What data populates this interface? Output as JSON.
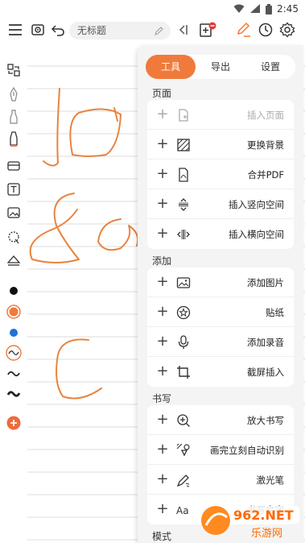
{
  "status_bar": {
    "time": "2:45"
  },
  "toolbar": {
    "title": "无标题"
  },
  "panel": {
    "tabs": [
      {
        "label": "工具",
        "active": true
      },
      {
        "label": "导出",
        "active": false
      },
      {
        "label": "设置",
        "active": false
      }
    ],
    "sections": [
      {
        "title": "页面",
        "items": [
          {
            "label": "插入页面",
            "icon": "insert-page-icon",
            "disabled": true
          },
          {
            "label": "更换背景",
            "icon": "change-background-icon",
            "disabled": false
          },
          {
            "label": "合并PDF",
            "icon": "pdf-icon",
            "disabled": false
          },
          {
            "label": "插入竖向空间",
            "icon": "vertical-space-icon",
            "disabled": false
          },
          {
            "label": "插入横向空间",
            "icon": "horizontal-space-icon",
            "disabled": false
          }
        ]
      },
      {
        "title": "添加",
        "items": [
          {
            "label": "添加图片",
            "icon": "image-icon",
            "disabled": false
          },
          {
            "label": "贴纸",
            "icon": "sticker-icon",
            "disabled": false
          },
          {
            "label": "添加录音",
            "icon": "microphone-icon",
            "disabled": false
          },
          {
            "label": "截屏插入",
            "icon": "crop-icon",
            "disabled": false
          }
        ]
      },
      {
        "title": "书写",
        "items": [
          {
            "label": "放大书写",
            "icon": "zoom-in-icon",
            "disabled": false
          },
          {
            "label": "画完立刻自动识别",
            "icon": "shape-recognize-icon",
            "disabled": false
          },
          {
            "label": "激光笔",
            "icon": "laser-pen-icon",
            "disabled": false
          },
          {
            "label": "书写文字",
            "icon": "text-icon",
            "disabled": false
          }
        ]
      },
      {
        "title": "模式",
        "items": []
      }
    ]
  },
  "colors": {
    "accent": "#f07a3b",
    "ink": "#e8843f",
    "black": "#111111",
    "blue": "#1e73d6"
  },
  "watermark": {
    "text": "962.NET",
    "subtext": "乐游网"
  }
}
